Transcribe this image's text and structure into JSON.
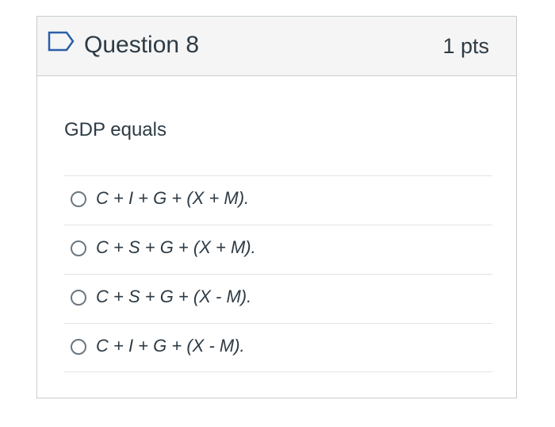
{
  "question": {
    "title": "Question 8",
    "points": "1 pts",
    "text": "GDP equals",
    "flag_icon": "flag-outline-icon"
  },
  "answers": [
    {
      "label": "C + I + G + (X + M).",
      "selected": false
    },
    {
      "label": "C + S + G + (X + M).",
      "selected": false
    },
    {
      "label": "C + S + G + (X - M).",
      "selected": false
    },
    {
      "label": "C + I + G + (X - M).",
      "selected": false
    }
  ],
  "colors": {
    "header_background": "#f5f5f5",
    "border": "#c7cdd1",
    "text": "#2d3b45",
    "flag": "#2b5ea8"
  }
}
